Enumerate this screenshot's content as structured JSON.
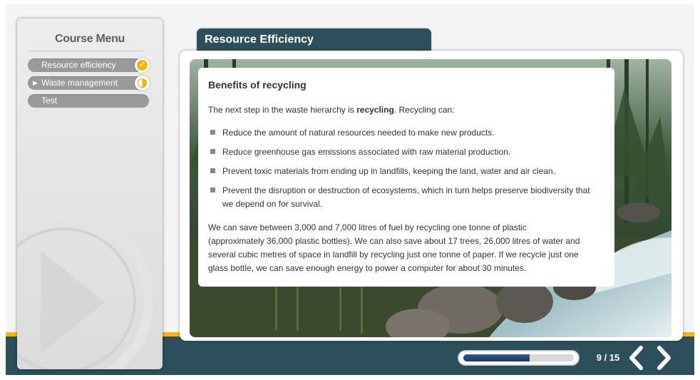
{
  "course_menu": {
    "title": "Course Menu",
    "items": [
      {
        "label": "Resource efficiency",
        "status": "complete"
      },
      {
        "label": "Waste management",
        "status": "in-progress",
        "current": true
      },
      {
        "label": "Test",
        "status": "none"
      }
    ]
  },
  "page": {
    "title": "Resource Efficiency",
    "heading": "Benefits of recycling",
    "intro_before": "The next step in the waste hierarchy is ",
    "intro_bold": "recycling",
    "intro_after": ". Recycling can:",
    "bullets": [
      "Reduce the amount of natural resources needed to make new products.",
      "Reduce greenhouse gas emissions associated with raw material production.",
      "Prevent toxic materials from ending up in landfills, keeping the land, water and air clean.",
      "Prevent the disruption or destruction of ecosystems, which in turn helps preserve biodiversity that we depend on for survival."
    ],
    "paragraph": "We can save between 3,000 and 7,000 litres of fuel by recycling one tonne of plastic (approximately 36,000 plastic bottles). We can also save about 17 trees, 26,000 litres of water and several cubic metres of space in landfill by recycling just one tonne of paper. If we recycle just one glass bottle, we can save enough energy to power a computer for about 30 minutes."
  },
  "navigation": {
    "page_counter": "9 / 15",
    "progress_fraction": 0.6
  },
  "icons": {
    "prev": "chevron-left-icon",
    "next": "chevron-right-icon",
    "complete": "check-icon",
    "in_progress": "half-circle-icon",
    "current": "triangle-right-icon"
  },
  "colors": {
    "header_bar": "#2c4f5c",
    "accent": "#f2b705",
    "menu_item": "#9a9a9a",
    "progress_fill": "#1f4672"
  }
}
